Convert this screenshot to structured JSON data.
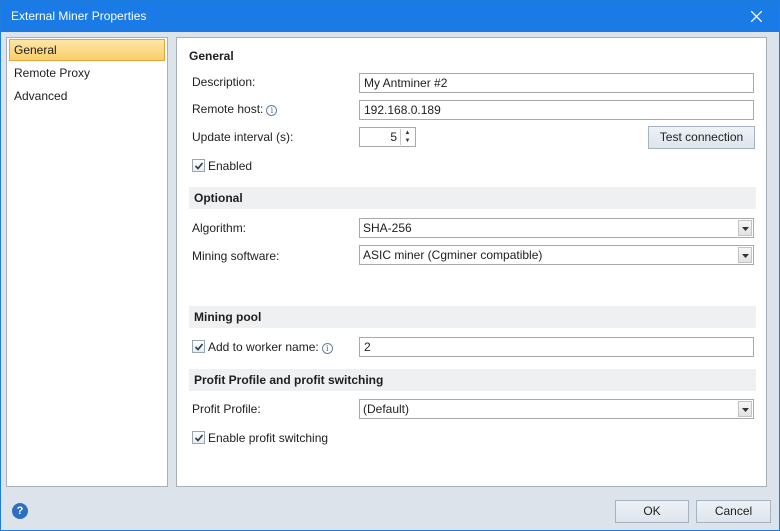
{
  "window": {
    "title": "External Miner Properties"
  },
  "nav": {
    "items": [
      "General",
      "Remote Proxy",
      "Advanced"
    ]
  },
  "general": {
    "heading": "General",
    "description_label": "Description:",
    "description_value": "My Antminer #2",
    "remote_host_label": "Remote host:",
    "remote_host_value": "192.168.0.189",
    "update_interval_label": "Update interval (s):",
    "update_interval_value": "5",
    "test_connection_label": "Test connection",
    "enabled_label": "Enabled",
    "enabled_checked": true
  },
  "optional": {
    "heading": "Optional",
    "algorithm_label": "Algorithm:",
    "algorithm_value": "SHA-256",
    "mining_software_label": "Mining software:",
    "mining_software_value": "ASIC miner (Cgminer compatible)"
  },
  "mining_pool": {
    "heading": "Mining pool",
    "add_worker_label": "Add to worker name:",
    "add_worker_checked": true,
    "worker_value": "2"
  },
  "profit": {
    "heading": "Profit Profile and profit switching",
    "profile_label": "Profit Profile:",
    "profile_value": "(Default)",
    "enable_switching_label": "Enable profit switching",
    "enable_switching_checked": true
  },
  "footer": {
    "ok_label": "OK",
    "cancel_label": "Cancel"
  },
  "icons": {
    "help": "help-icon",
    "info": "info-icon",
    "close": "close-icon"
  },
  "colors": {
    "titlebar": "#1a7ae6",
    "selection": "#fbcf6a"
  }
}
